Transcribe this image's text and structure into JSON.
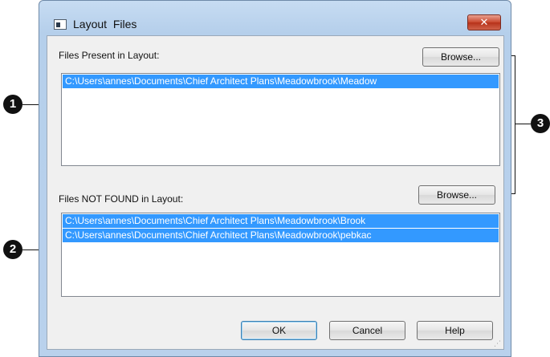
{
  "window": {
    "title": "Layout  Files",
    "close_label": "✕"
  },
  "present": {
    "label": "Files Present in Layout:",
    "browse_label": "Browse...",
    "files": [
      "C:\\Users\\annes\\Documents\\Chief Architect Plans\\Meadowbrook\\Meadow"
    ]
  },
  "not_found": {
    "label": "Files NOT FOUND in Layout:",
    "browse_label": "Browse...",
    "files": [
      "C:\\Users\\annes\\Documents\\Chief Architect Plans\\Meadowbrook\\Brook",
      "C:\\Users\\annes\\Documents\\Chief Architect Plans\\Meadowbrook\\pebkac"
    ]
  },
  "footer": {
    "ok_label": "OK",
    "cancel_label": "Cancel",
    "help_label": "Help"
  },
  "callouts": {
    "one": "1",
    "two": "2",
    "three": "3"
  },
  "colors": {
    "selection": "#3399ff",
    "close_button": "#c9462c"
  }
}
